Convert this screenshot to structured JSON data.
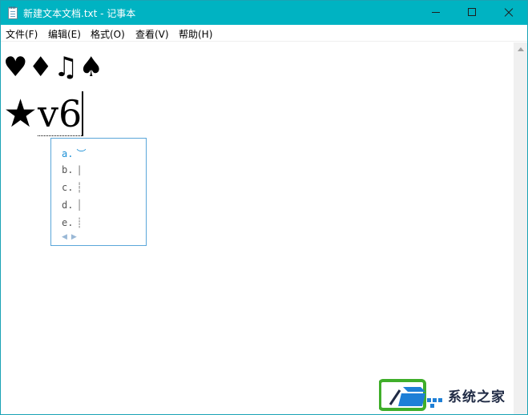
{
  "window": {
    "title": "新建文本文档.txt - 记事本",
    "accent_color": "#00b3c2"
  },
  "menu": {
    "items": [
      "文件(F)",
      "编辑(E)",
      "格式(O)",
      "查看(V)",
      "帮助(H)"
    ]
  },
  "editor": {
    "line1": "♥♦♫♠",
    "line2_symbol": "★",
    "composition": "v6"
  },
  "ime": {
    "candidates": [
      {
        "label": "a.",
        "symbol": "︶"
      },
      {
        "label": "b.",
        "symbol": "|"
      },
      {
        "label": "c.",
        "symbol": "┆"
      },
      {
        "label": "d.",
        "symbol": "│"
      },
      {
        "label": "e.",
        "symbol": "┊"
      }
    ],
    "selected_index": 0,
    "pager_prev": "◀",
    "pager_next": "▶"
  },
  "watermark": {
    "text": "系统之家"
  }
}
